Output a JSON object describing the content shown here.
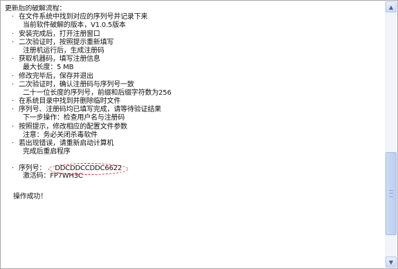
{
  "title": "更新后的破解流程：",
  "lines": [
    "在文件系统中找到对应的序列号并记录下来",
    "当前软件破解的版本，V1.0.5版本",
    "安装完成后，打开注册窗口",
    "二次验证时，按照提示重新填写",
    "注册机运行后，生成注册码",
    "获取机器码，填写注册信息",
    "最大长度：5 MB",
    "修改完毕后，保存并退出",
    "二次验证时，确认注册码与序列号一致",
    "二十一位长度的序列号，前缀和后缀字符数为256",
    "在系统目录中找到并删除临时文件",
    "序列号、注册码均已填写完成，请等待验证结果",
    "下一步操作：检查用户名与注册码",
    "按照提示，修改相应的配置文件参数",
    "注意：务必关闭杀毒软件",
    "若出现错误，请重新启动计算机",
    "完成后重启程序"
  ],
  "serial": {
    "label": "序列号：",
    "value": "DDCDDCCDDC6622",
    "label2": "激活码：",
    "value2": "FP7WH3C"
  },
  "footer": "操作成功！"
}
